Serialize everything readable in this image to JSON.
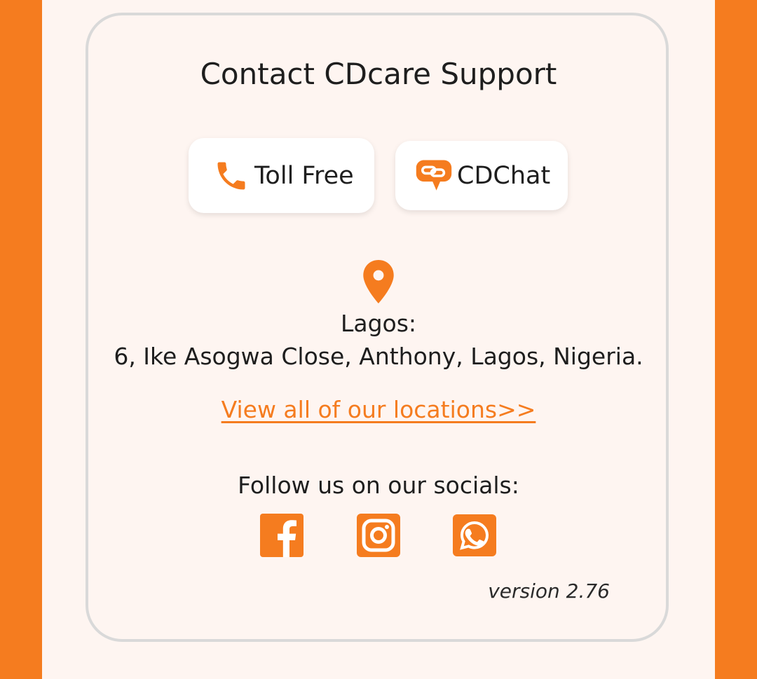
{
  "theme": {
    "accent": "#F57C1F",
    "background": "#FEF5F1",
    "card_border": "#D9D9D9",
    "text": "#1E1E1E"
  },
  "support": {
    "title": "Contact CDcare Support",
    "toll_free": {
      "label": "Toll Free",
      "icon": "phone-icon"
    },
    "cdchat": {
      "label": "CDChat",
      "icon": "chat-link-icon"
    }
  },
  "location": {
    "icon": "location-pin-icon",
    "city": "Lagos:",
    "address": "6, Ike Asogwa Close, Anthony, Lagos, Nigeria.",
    "view_all_link": "View all of our locations>>"
  },
  "socials": {
    "label": "Follow us on our socials:",
    "items": [
      {
        "name": "facebook",
        "icon": "facebook-icon"
      },
      {
        "name": "instagram",
        "icon": "instagram-icon"
      },
      {
        "name": "whatsapp",
        "icon": "whatsapp-icon"
      }
    ]
  },
  "app": {
    "version": "version 2.76"
  }
}
